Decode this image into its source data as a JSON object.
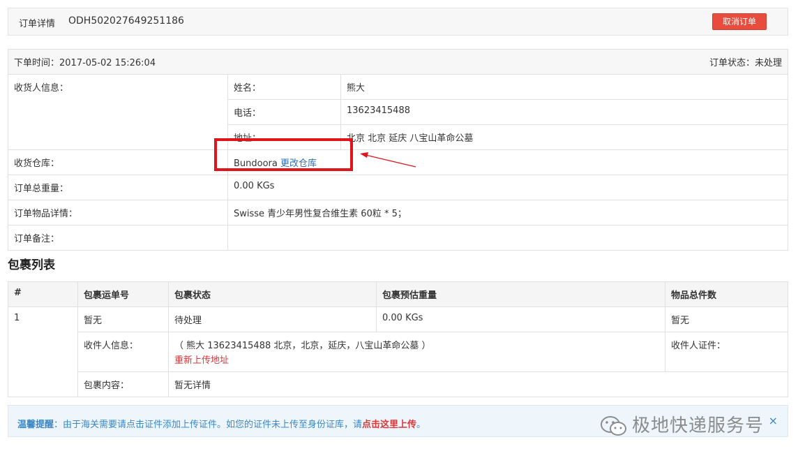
{
  "header": {
    "label": "订单详情",
    "order_no": "ODH502027649251186",
    "cancel_label": "取消订单"
  },
  "order": {
    "time_label": "下单时间：",
    "time_value": "2017-05-02 15:26:04",
    "status_label": "订单状态：",
    "status_value": "未处理",
    "receiver_label": "收货人信息：",
    "name_label": "姓名：",
    "name_value": "熊大",
    "phone_label": "电话：",
    "phone_value": "13623415488",
    "address_label": "地址：",
    "address_value": " 北京 北京 延庆 八宝山革命公墓",
    "warehouse_label": "收货仓库：",
    "warehouse_value": "Bundoora",
    "change_warehouse": "更改仓库",
    "weight_label": "订单总重量：",
    "weight_value": "0.00 KGs",
    "items_label": "订单物品详情：",
    "items_value": "Swisse 青少年男性复合维生素 60粒 * 5；",
    "remark_label": "订单备注：",
    "remark_value": ""
  },
  "packages": {
    "title": "包裹列表",
    "columns": [
      "#",
      "包裹运单号",
      "包裹状态",
      "包裹预估重量",
      "物品总件数"
    ],
    "rows": [
      {
        "index": "1",
        "tracking": "暂无",
        "status": "待处理",
        "weight": "0.00 KGs",
        "count": "暂无",
        "recipient_label": "收件人信息：",
        "recipient_value": "（ 熊大  13623415488  北京，北京，延庆，八宝山革命公墓 ）",
        "reupload": "重新上传地址",
        "id_label": "收件人证件：",
        "content_label": "包裹内容：",
        "content_value": "暂无详情"
      }
    ]
  },
  "notice": {
    "prefix": "温馨提醒",
    "text": "：由于海关需要请点击证件添加上传证件。如您的证件未上传至身份证库，请",
    "link": "点击这里上传",
    "suffix": "。",
    "close": "×"
  },
  "watermark": {
    "text": "极地快递服务号",
    "icon": "wechat-icon"
  },
  "colors": {
    "accent": "#e74c3c",
    "link": "#2a6fb5",
    "highlight": "#e0141b"
  }
}
